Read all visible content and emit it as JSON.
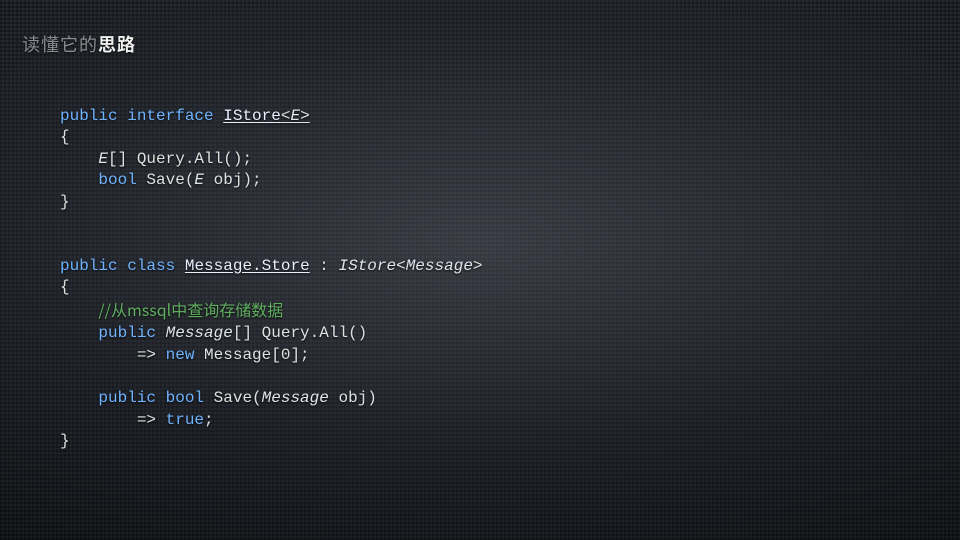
{
  "title": {
    "prefix": "读懂它的",
    "emph": "思路"
  },
  "code1": {
    "kw_public": "public",
    "kw_interface": "interface",
    "iface_name": "IStore",
    "lt": "<",
    "tparam": "E",
    "gt": ">",
    "lbrace": "{",
    "line_arr_type": "E",
    "line_arr_suffix": "[] Query.All();",
    "kw_bool": "bool",
    "save_sig": " Save(",
    "save_ptype": "E",
    "save_rest": " obj);",
    "rbrace": "}"
  },
  "code2": {
    "kw_public": "public",
    "kw_class": "class",
    "class_name": "Message.Store",
    "colon": " : ",
    "impl_iface": "IStore",
    "lt": "<",
    "impl_targ": "Message",
    "gt": ">",
    "lbrace": "{",
    "comment": "//从mssql中查询存储数据",
    "m1_kw_public": "public",
    "m1_ret": "Message",
    "m1_ret_suffix": "[] Query.All()",
    "m1_arrow": "=> ",
    "m1_kw_new": "new",
    "m1_body": " Message[0];",
    "m2_kw_public": "public",
    "m2_kw_bool": "bool",
    "m2_sig": " Save(",
    "m2_ptype": "Message",
    "m2_rest": " obj)",
    "m2_arrow": "=> ",
    "m2_kw_true": "true",
    "m2_semi": ";",
    "rbrace": "}"
  }
}
